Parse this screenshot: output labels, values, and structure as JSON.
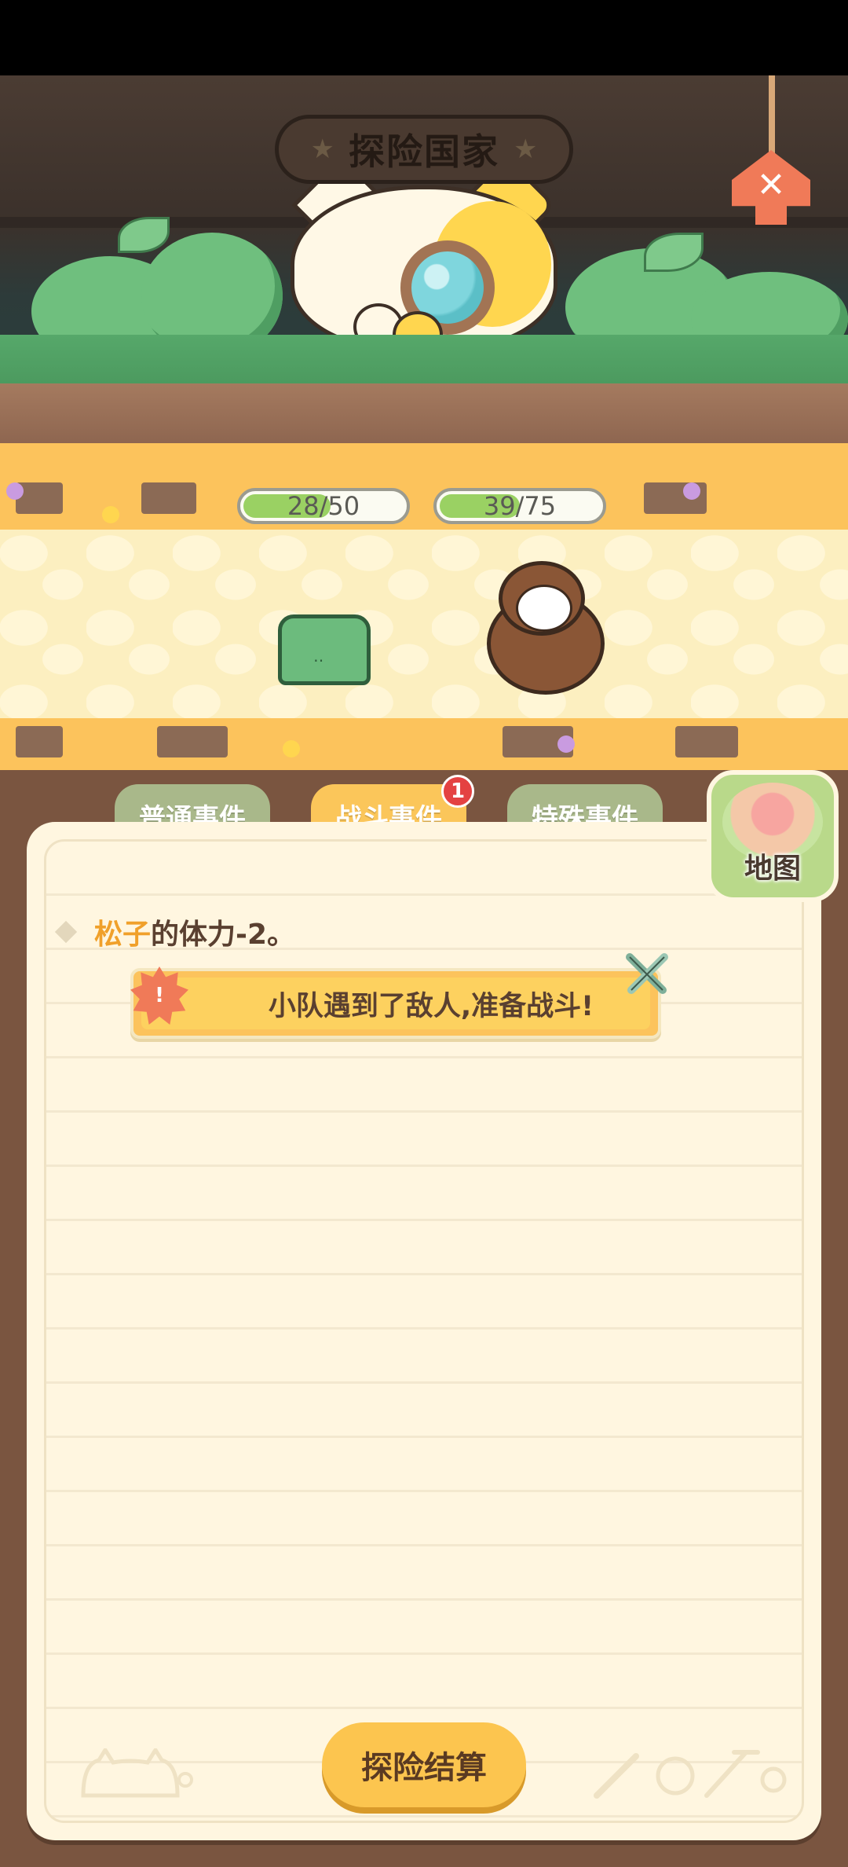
{
  "header": {
    "title": "探险国家"
  },
  "party_hp": [
    {
      "text": "28/50",
      "fraction": 0.56
    },
    {
      "text": "39/75",
      "fraction": 0.52
    }
  ],
  "tabs": [
    {
      "label": "普通事件"
    },
    {
      "label": "战斗事件",
      "badge": "1"
    },
    {
      "label": "特殊事件"
    }
  ],
  "map_button": {
    "label": "地图"
  },
  "log": {
    "entry_name": "松子",
    "entry_text": "的体力-2。",
    "banner_icon": "!",
    "banner_text": "小队遇到了敌人,准备战斗!"
  },
  "settle_button": {
    "label": "探险结算"
  },
  "colors": {
    "accent": "#fcc35c",
    "hp_fill": "#9ad163",
    "badge": "#e44242",
    "close": "#f07a58"
  }
}
